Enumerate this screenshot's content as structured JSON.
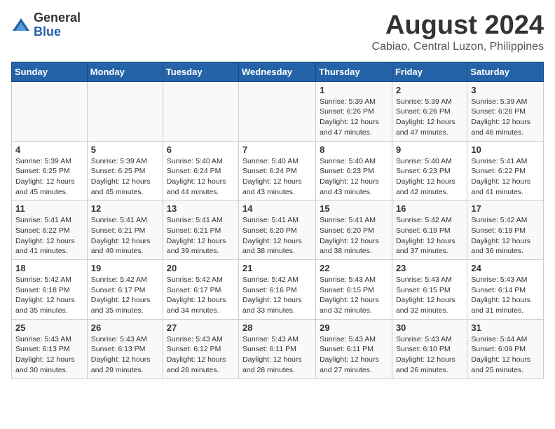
{
  "header": {
    "logo_general": "General",
    "logo_blue": "Blue",
    "title": "August 2024",
    "subtitle": "Cabiao, Central Luzon, Philippines"
  },
  "weekdays": [
    "Sunday",
    "Monday",
    "Tuesday",
    "Wednesday",
    "Thursday",
    "Friday",
    "Saturday"
  ],
  "weeks": [
    [
      {
        "day": "",
        "detail": ""
      },
      {
        "day": "",
        "detail": ""
      },
      {
        "day": "",
        "detail": ""
      },
      {
        "day": "",
        "detail": ""
      },
      {
        "day": "1",
        "detail": "Sunrise: 5:39 AM\nSunset: 6:26 PM\nDaylight: 12 hours\nand 47 minutes."
      },
      {
        "day": "2",
        "detail": "Sunrise: 5:39 AM\nSunset: 6:26 PM\nDaylight: 12 hours\nand 47 minutes."
      },
      {
        "day": "3",
        "detail": "Sunrise: 5:39 AM\nSunset: 6:26 PM\nDaylight: 12 hours\nand 46 minutes."
      }
    ],
    [
      {
        "day": "4",
        "detail": "Sunrise: 5:39 AM\nSunset: 6:25 PM\nDaylight: 12 hours\nand 45 minutes."
      },
      {
        "day": "5",
        "detail": "Sunrise: 5:39 AM\nSunset: 6:25 PM\nDaylight: 12 hours\nand 45 minutes."
      },
      {
        "day": "6",
        "detail": "Sunrise: 5:40 AM\nSunset: 6:24 PM\nDaylight: 12 hours\nand 44 minutes."
      },
      {
        "day": "7",
        "detail": "Sunrise: 5:40 AM\nSunset: 6:24 PM\nDaylight: 12 hours\nand 43 minutes."
      },
      {
        "day": "8",
        "detail": "Sunrise: 5:40 AM\nSunset: 6:23 PM\nDaylight: 12 hours\nand 43 minutes."
      },
      {
        "day": "9",
        "detail": "Sunrise: 5:40 AM\nSunset: 6:23 PM\nDaylight: 12 hours\nand 42 minutes."
      },
      {
        "day": "10",
        "detail": "Sunrise: 5:41 AM\nSunset: 6:22 PM\nDaylight: 12 hours\nand 41 minutes."
      }
    ],
    [
      {
        "day": "11",
        "detail": "Sunrise: 5:41 AM\nSunset: 6:22 PM\nDaylight: 12 hours\nand 41 minutes."
      },
      {
        "day": "12",
        "detail": "Sunrise: 5:41 AM\nSunset: 6:21 PM\nDaylight: 12 hours\nand 40 minutes."
      },
      {
        "day": "13",
        "detail": "Sunrise: 5:41 AM\nSunset: 6:21 PM\nDaylight: 12 hours\nand 39 minutes."
      },
      {
        "day": "14",
        "detail": "Sunrise: 5:41 AM\nSunset: 6:20 PM\nDaylight: 12 hours\nand 38 minutes."
      },
      {
        "day": "15",
        "detail": "Sunrise: 5:41 AM\nSunset: 6:20 PM\nDaylight: 12 hours\nand 38 minutes."
      },
      {
        "day": "16",
        "detail": "Sunrise: 5:42 AM\nSunset: 6:19 PM\nDaylight: 12 hours\nand 37 minutes."
      },
      {
        "day": "17",
        "detail": "Sunrise: 5:42 AM\nSunset: 6:19 PM\nDaylight: 12 hours\nand 36 minutes."
      }
    ],
    [
      {
        "day": "18",
        "detail": "Sunrise: 5:42 AM\nSunset: 6:18 PM\nDaylight: 12 hours\nand 35 minutes."
      },
      {
        "day": "19",
        "detail": "Sunrise: 5:42 AM\nSunset: 6:17 PM\nDaylight: 12 hours\nand 35 minutes."
      },
      {
        "day": "20",
        "detail": "Sunrise: 5:42 AM\nSunset: 6:17 PM\nDaylight: 12 hours\nand 34 minutes."
      },
      {
        "day": "21",
        "detail": "Sunrise: 5:42 AM\nSunset: 6:16 PM\nDaylight: 12 hours\nand 33 minutes."
      },
      {
        "day": "22",
        "detail": "Sunrise: 5:43 AM\nSunset: 6:15 PM\nDaylight: 12 hours\nand 32 minutes."
      },
      {
        "day": "23",
        "detail": "Sunrise: 5:43 AM\nSunset: 6:15 PM\nDaylight: 12 hours\nand 32 minutes."
      },
      {
        "day": "24",
        "detail": "Sunrise: 5:43 AM\nSunset: 6:14 PM\nDaylight: 12 hours\nand 31 minutes."
      }
    ],
    [
      {
        "day": "25",
        "detail": "Sunrise: 5:43 AM\nSunset: 6:13 PM\nDaylight: 12 hours\nand 30 minutes."
      },
      {
        "day": "26",
        "detail": "Sunrise: 5:43 AM\nSunset: 6:13 PM\nDaylight: 12 hours\nand 29 minutes."
      },
      {
        "day": "27",
        "detail": "Sunrise: 5:43 AM\nSunset: 6:12 PM\nDaylight: 12 hours\nand 28 minutes."
      },
      {
        "day": "28",
        "detail": "Sunrise: 5:43 AM\nSunset: 6:11 PM\nDaylight: 12 hours\nand 28 minutes."
      },
      {
        "day": "29",
        "detail": "Sunrise: 5:43 AM\nSunset: 6:11 PM\nDaylight: 12 hours\nand 27 minutes."
      },
      {
        "day": "30",
        "detail": "Sunrise: 5:43 AM\nSunset: 6:10 PM\nDaylight: 12 hours\nand 26 minutes."
      },
      {
        "day": "31",
        "detail": "Sunrise: 5:44 AM\nSunset: 6:09 PM\nDaylight: 12 hours\nand 25 minutes."
      }
    ]
  ]
}
